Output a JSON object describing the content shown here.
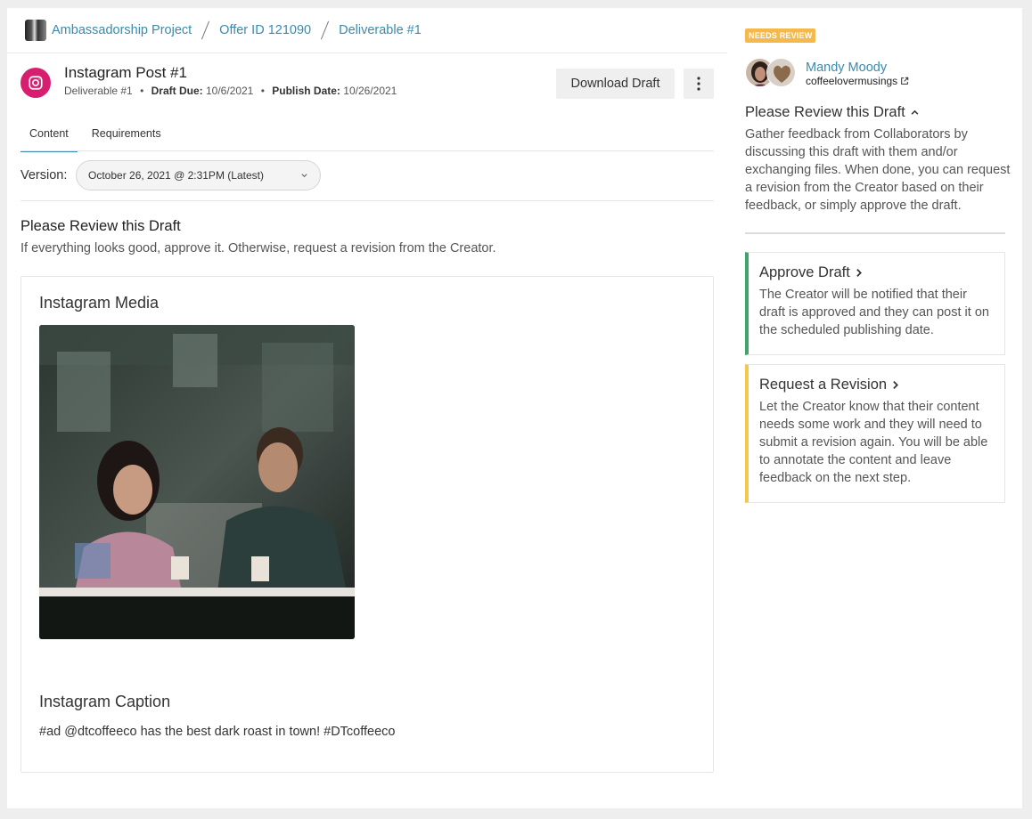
{
  "breadcrumb": {
    "items": [
      {
        "label": "Ambassadorship Project"
      },
      {
        "label": "Offer ID 121090"
      },
      {
        "label": "Deliverable #1"
      }
    ]
  },
  "post": {
    "title": "Instagram Post #1",
    "deliverable": "Deliverable #1",
    "draft_due_label": "Draft Due:",
    "draft_due": "10/6/2021",
    "publish_date_label": "Publish Date:",
    "publish_date": "10/26/2021",
    "separator": "•"
  },
  "toolbar": {
    "download_label": "Download Draft",
    "more_icon": "more-vertical-icon"
  },
  "tabs": [
    {
      "label": "Content",
      "active": true
    },
    {
      "label": "Requirements",
      "active": false
    }
  ],
  "version": {
    "label": "Version:",
    "selected": "October 26, 2021 @ 2:31PM (Latest)"
  },
  "review": {
    "title": "Please Review this Draft",
    "subtitle": "If everything looks good, approve it. Otherwise, request a revision from the Creator."
  },
  "content": {
    "media_title": "Instagram Media",
    "caption_title": "Instagram Caption",
    "caption_text": "#ad @dtcoffeeco has the best dark roast in town! #DTcoffeeco"
  },
  "sidebar": {
    "badge": "NEEDS REVIEW",
    "creator_name": "Mandy Moody",
    "creator_handle": "coffeelovermusings",
    "panel_title": "Please Review this Draft",
    "panel_desc": "Gather feedback from Collaborators by discussing this draft with them and/or exchanging files. When done, you can request a revision from the Creator based on their feedback, or simply approve the draft.",
    "approve": {
      "title": "Approve Draft",
      "desc": "The Creator will be notified that their draft is approved and they can post it on the scheduled publishing date."
    },
    "revise": {
      "title": "Request a Revision",
      "desc": "Let the Creator know that their content needs some work and they will need to submit a revision again. You will be able to annotate the content and leave feedback on the next step."
    }
  },
  "colors": {
    "link": "#3a8bad",
    "badge": "#f5b94b",
    "approve": "#3fa66b",
    "revise": "#f5c84b",
    "instagram": "#d6206f"
  }
}
